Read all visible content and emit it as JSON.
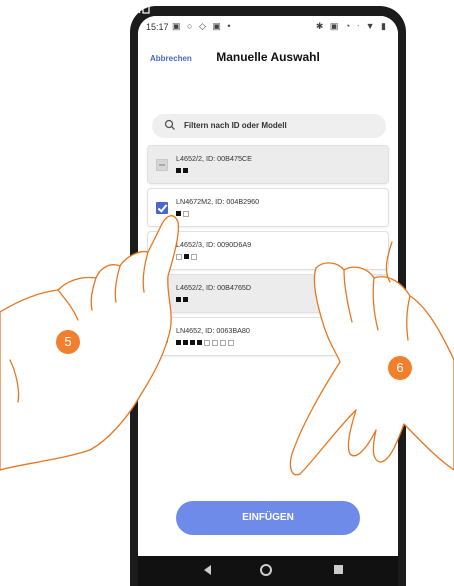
{
  "status_bar": {
    "time": "15:17",
    "icons_left": "▣ ○ ◇ ▣ •",
    "icons_right": "✱ ▣ ◔ ᐧ ▼ ▮"
  },
  "header": {
    "cancel_label": "Abbrechen",
    "title": "Manuelle Auswahl"
  },
  "search": {
    "placeholder": "Filtern nach ID oder Modell"
  },
  "devices": [
    {
      "label": "L4652/2, ID: 00B475CE",
      "state": "disabled",
      "squares": [
        1,
        1
      ]
    },
    {
      "label": "LN4672M2, ID: 004B2960",
      "state": "checked",
      "squares": [
        1,
        0
      ]
    },
    {
      "label": "L4652/3, ID: 0090D6A9",
      "state": "unchecked",
      "squares": [
        0,
        1,
        0
      ]
    },
    {
      "label": "L4652/2, ID: 00B4765D",
      "state": "disabled",
      "squares": [
        1,
        1
      ]
    },
    {
      "label": "LN4652, ID: 0063BA80",
      "state": "unchecked",
      "squares": [
        1,
        1,
        1,
        1,
        0,
        0,
        0,
        0
      ]
    }
  ],
  "insert_button": {
    "label": "EINFÜGEN"
  },
  "steps": {
    "step5": "5",
    "step6": "6"
  },
  "colors": {
    "accent": "#4a67c9",
    "button": "#6f8bea",
    "step_badge": "#f07f2e"
  }
}
